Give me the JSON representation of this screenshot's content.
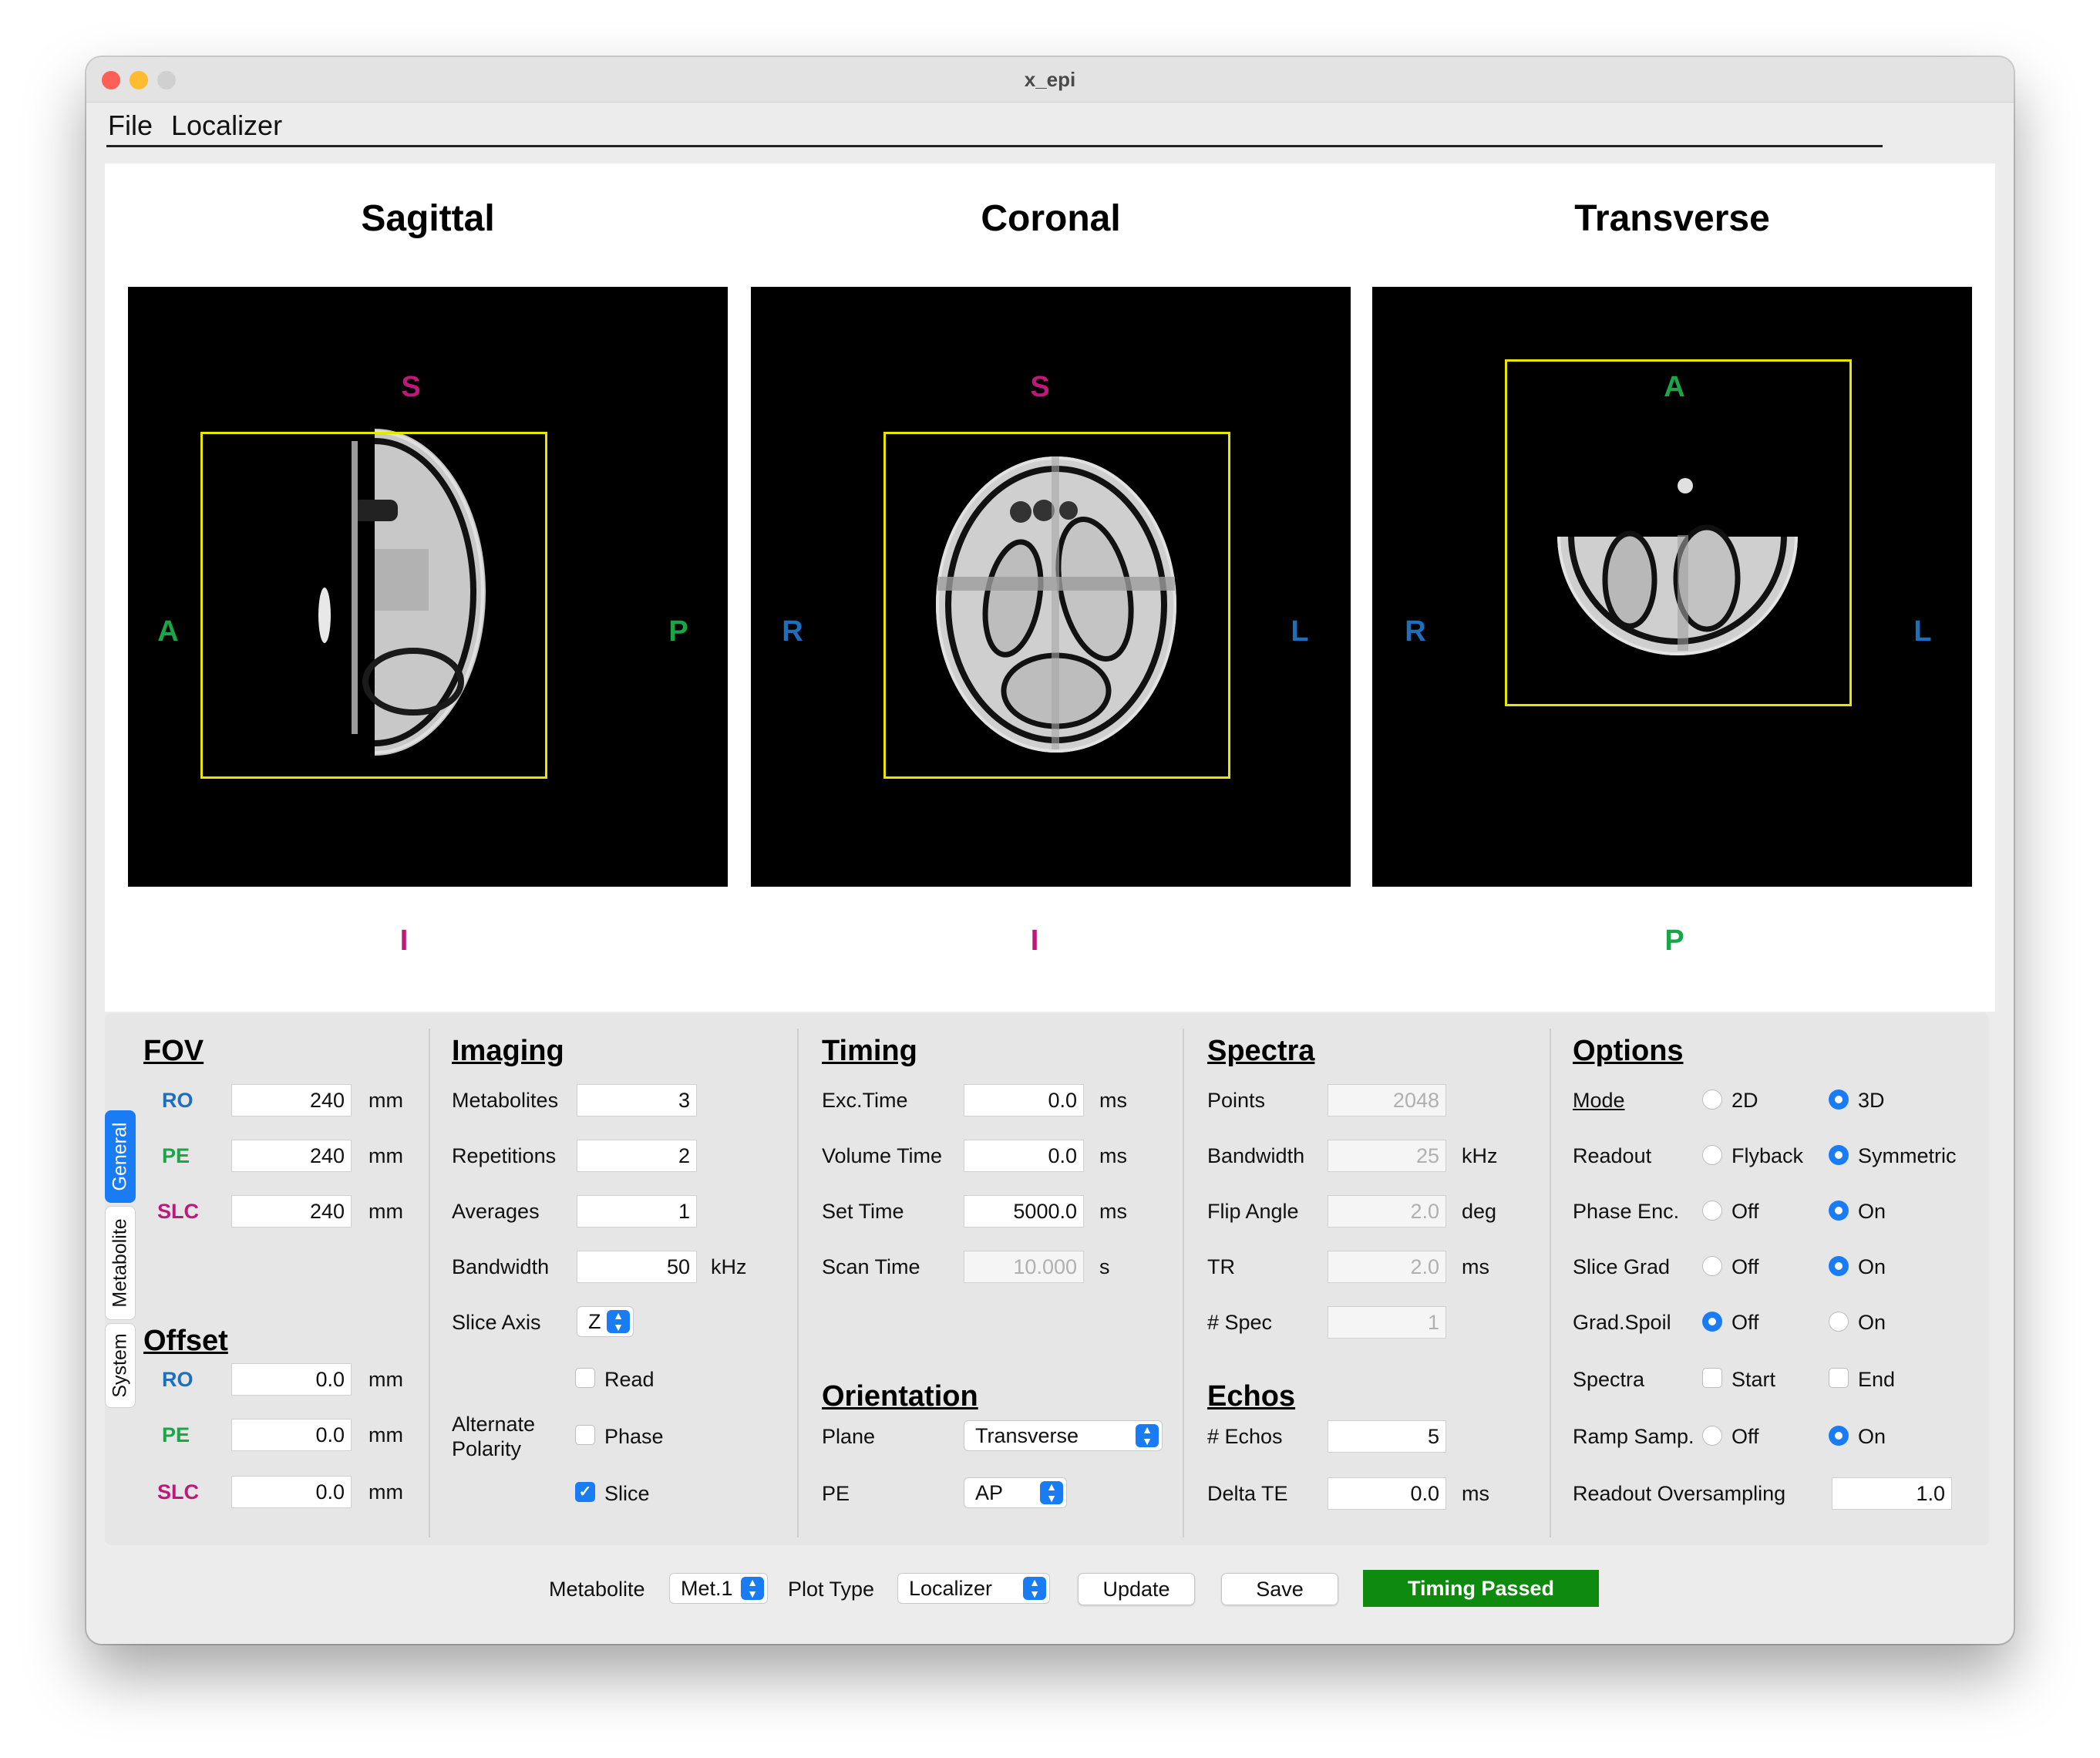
{
  "window": {
    "title": "x_epi"
  },
  "menu": {
    "file": "File",
    "localizer": "Localizer"
  },
  "views": [
    {
      "title": "Sagittal",
      "top": "S",
      "bottom": "I",
      "left": "A",
      "right": "P"
    },
    {
      "title": "Coronal",
      "top": "S",
      "bottom": "I",
      "left": "R",
      "right": "L"
    },
    {
      "title": "Transverse",
      "top": "A",
      "bottom": "P",
      "left": "R",
      "right": "L"
    }
  ],
  "colors": {
    "si": "#c0187a",
    "ap": "#1aa548",
    "rl": "#1d6fbd",
    "accent": "#1a7cf5",
    "status": "#0e8a0e",
    "roi": "#e6e600"
  },
  "tabs": {
    "general": "General",
    "metabolite": "Metabolite",
    "system": "System"
  },
  "fov": {
    "title": "FOV",
    "ro": {
      "label": "RO",
      "value": "240",
      "unit": "mm"
    },
    "pe": {
      "label": "PE",
      "value": "240",
      "unit": "mm"
    },
    "slc": {
      "label": "SLC",
      "value": "240",
      "unit": "mm"
    }
  },
  "offset": {
    "title": "Offset",
    "ro": {
      "label": "RO",
      "value": "0.0",
      "unit": "mm"
    },
    "pe": {
      "label": "PE",
      "value": "0.0",
      "unit": "mm"
    },
    "slc": {
      "label": "SLC",
      "value": "0.0",
      "unit": "mm"
    }
  },
  "imaging": {
    "title": "Imaging",
    "metabolites": {
      "label": "Metabolites",
      "value": "3"
    },
    "repetitions": {
      "label": "Repetitions",
      "value": "2"
    },
    "averages": {
      "label": "Averages",
      "value": "1"
    },
    "bandwidth": {
      "label": "Bandwidth",
      "value": "50",
      "unit": "kHz"
    },
    "slice_axis": {
      "label": "Slice Axis",
      "value": "Z"
    },
    "alt_polarity": {
      "label1": "Alternate",
      "label2": "Polarity",
      "read": "Read",
      "phase": "Phase",
      "slice": "Slice"
    }
  },
  "timing": {
    "title": "Timing",
    "exc_time": {
      "label": "Exc.Time",
      "value": "0.0",
      "unit": "ms"
    },
    "volume_time": {
      "label": "Volume Time",
      "value": "0.0",
      "unit": "ms"
    },
    "set_time": {
      "label": "Set Time",
      "value": "5000.0",
      "unit": "ms"
    },
    "scan_time": {
      "label": "Scan Time",
      "value": "10.000",
      "unit": "s"
    }
  },
  "orientation": {
    "title": "Orientation",
    "plane": {
      "label": "Plane",
      "value": "Transverse"
    },
    "pe": {
      "label": "PE",
      "value": "AP"
    }
  },
  "spectra": {
    "title": "Spectra",
    "points": {
      "label": "Points",
      "value": "2048"
    },
    "bandwidth": {
      "label": "Bandwidth",
      "value": "25",
      "unit": "kHz"
    },
    "flip_angle": {
      "label": "Flip Angle",
      "value": "2.0",
      "unit": "deg"
    },
    "tr": {
      "label": "TR",
      "value": "2.0",
      "unit": "ms"
    },
    "n_spec": {
      "label": "# Spec",
      "value": "1"
    }
  },
  "echos": {
    "title": "Echos",
    "n_echos": {
      "label": "# Echos",
      "value": "5"
    },
    "delta_te": {
      "label": "Delta TE",
      "value": "0.0",
      "unit": "ms"
    }
  },
  "options": {
    "title": "Options",
    "mode": {
      "label": "Mode",
      "a": "2D",
      "b": "3D"
    },
    "readout": {
      "label": "Readout",
      "a": "Flyback",
      "b": "Symmetric"
    },
    "phase_enc": {
      "label": "Phase Enc.",
      "a": "Off",
      "b": "On"
    },
    "slice_grad": {
      "label": "Slice Grad",
      "a": "Off",
      "b": "On"
    },
    "grad_spoil": {
      "label": "Grad.Spoil",
      "a": "Off",
      "b": "On"
    },
    "spectra": {
      "label": "Spectra",
      "a": "Start",
      "b": "End"
    },
    "ramp_samp": {
      "label": "Ramp Samp.",
      "a": "Off",
      "b": "On"
    },
    "readout_os": {
      "label": "Readout Oversampling",
      "value": "1.0"
    }
  },
  "bottom": {
    "metabolite_label": "Metabolite",
    "metabolite_value": "Met.1",
    "plot_type_label": "Plot Type",
    "plot_type_value": "Localizer",
    "update": "Update",
    "save": "Save",
    "status": "Timing Passed"
  }
}
